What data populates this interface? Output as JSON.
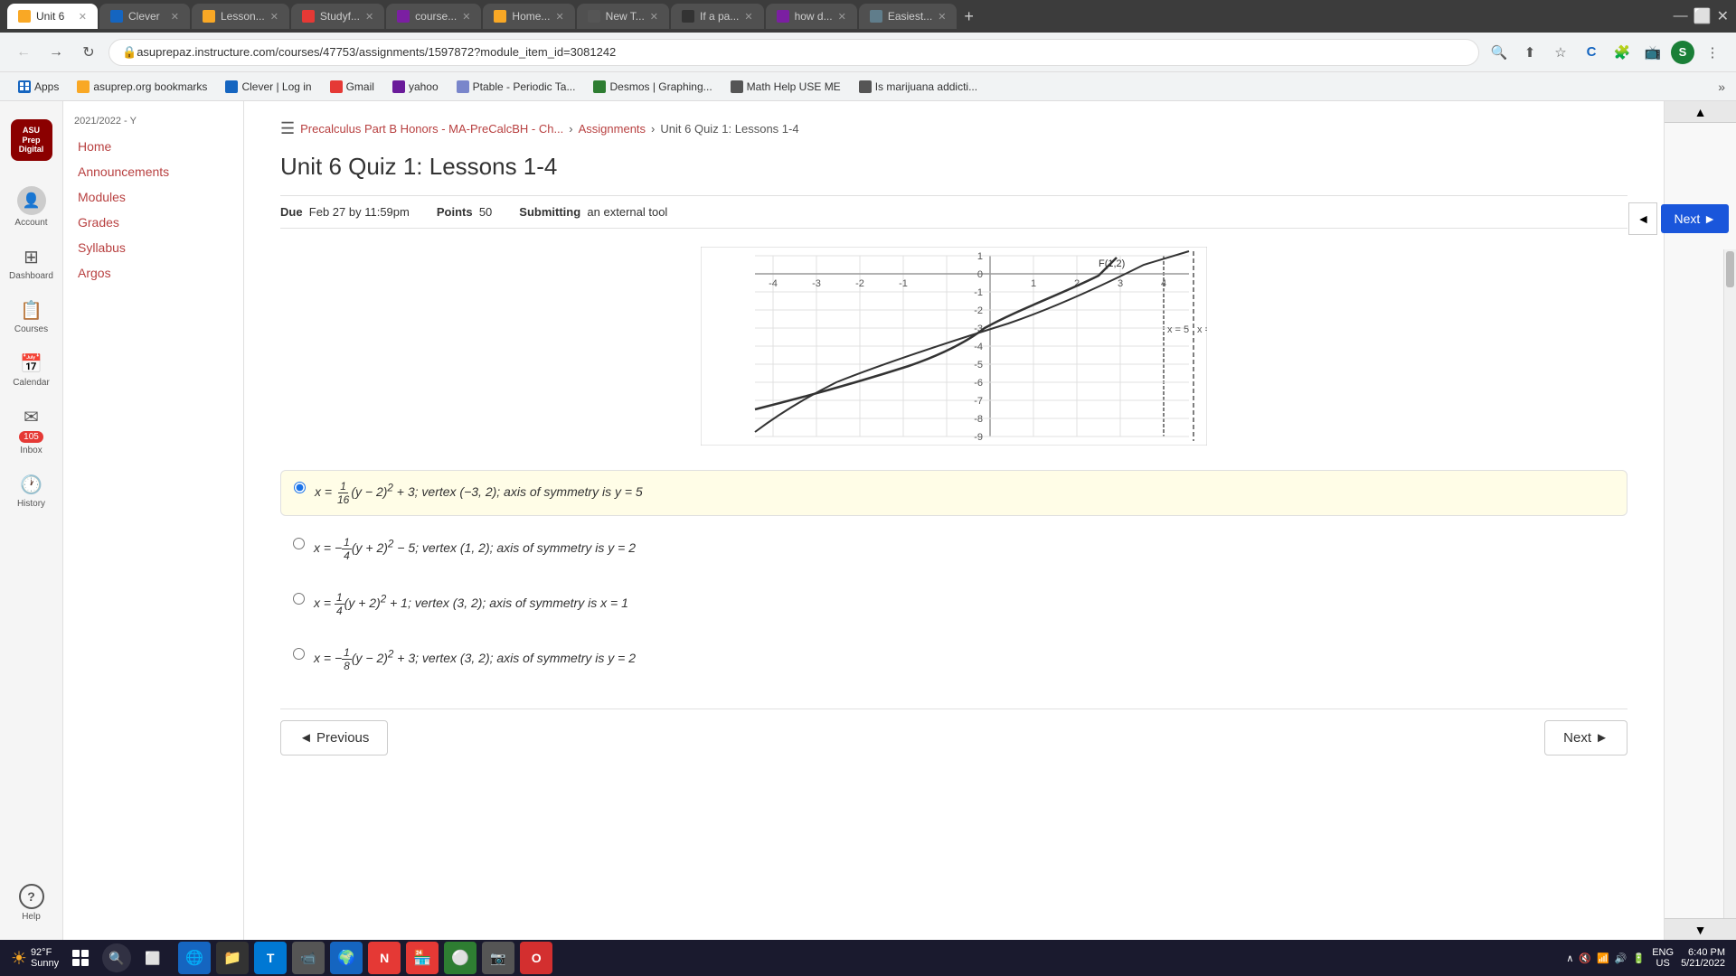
{
  "browser": {
    "tabs": [
      {
        "id": "clever",
        "title": "Clever",
        "active": false,
        "color": "#1565c0"
      },
      {
        "id": "lesson",
        "title": "Lesson...",
        "active": false,
        "color": "#f9a825"
      },
      {
        "id": "unit6",
        "title": "Unit 6",
        "active": true,
        "color": "#f9a825"
      },
      {
        "id": "studyf",
        "title": "Studyf...",
        "active": false,
        "color": "#e53935"
      },
      {
        "id": "course",
        "title": "course...",
        "active": false,
        "color": "#7b1fa2"
      },
      {
        "id": "home",
        "title": "Home...",
        "active": false,
        "color": "#f9a825"
      },
      {
        "id": "newt",
        "title": "New T...",
        "active": false,
        "color": "#555"
      },
      {
        "id": "ifapa",
        "title": "If a pa...",
        "active": false,
        "color": "#333"
      },
      {
        "id": "howd",
        "title": "how d...",
        "active": false,
        "color": "#7b1fa2"
      },
      {
        "id": "easiest",
        "title": "Easiest...",
        "active": false,
        "color": "#607d8b"
      }
    ],
    "url": "asuprepaz.instructure.com/courses/47753/assignments/1597872?module_item_id=3081242",
    "bookmarks": [
      {
        "label": "Apps",
        "color": "#1565c0"
      },
      {
        "label": "asuprep.org bookmarks"
      },
      {
        "label": "Clever | Log in",
        "color": "#1565c0"
      },
      {
        "label": "Gmail",
        "color": "#e53935"
      },
      {
        "label": "yahoo",
        "color": "#6a1b9a"
      },
      {
        "label": "Ptable - Periodic Ta...",
        "color": "#7986cb"
      },
      {
        "label": "Desmos | Graphing...",
        "color": "#2e7d32"
      },
      {
        "label": "Math Help USE ME",
        "color": "#555"
      },
      {
        "label": "Is marijuana addicti...",
        "color": "#555"
      }
    ]
  },
  "left_nav": {
    "logo_lines": [
      "ASU",
      "Prep",
      "Digital"
    ],
    "items": [
      {
        "id": "account",
        "icon": "👤",
        "label": "Account"
      },
      {
        "id": "dashboard",
        "icon": "⊞",
        "label": "Dashboard"
      },
      {
        "id": "courses",
        "icon": "📋",
        "label": "Courses"
      },
      {
        "id": "calendar",
        "icon": "📅",
        "label": "Calendar"
      },
      {
        "id": "inbox",
        "icon": "✉",
        "label": "Inbox",
        "badge": "105"
      },
      {
        "id": "history",
        "icon": "🕐",
        "label": "History"
      },
      {
        "id": "help",
        "icon": "?",
        "label": "Help"
      }
    ]
  },
  "sidebar": {
    "year": "2021/2022 - Y",
    "links": [
      {
        "label": "Home"
      },
      {
        "label": "Announcements"
      },
      {
        "label": "Modules"
      },
      {
        "label": "Grades"
      },
      {
        "label": "Syllabus"
      },
      {
        "label": "Argos"
      }
    ]
  },
  "breadcrumb": {
    "course": "Precalculus Part B Honors - MA-PreCalcBH - Ch...",
    "assignments": "Assignments",
    "current": "Unit 6 Quiz 1: Lessons 1-4"
  },
  "quiz": {
    "title": "Unit 6 Quiz 1: Lessons 1-4",
    "due_label": "Due",
    "due_value": "Feb 27 by 11:59pm",
    "points_label": "Points",
    "points_value": "50",
    "submitting_label": "Submitting",
    "submitting_value": "an external tool"
  },
  "graph": {
    "focus_label": "F(1,2)",
    "directrix_label": "x = 5",
    "x_min": -5,
    "x_max": 5,
    "y_min": -9,
    "y_max": 1
  },
  "choices": [
    {
      "id": "a",
      "selected": true,
      "text": "x = 1/16(y − 2)² + 3; vertex (−3, 2); axis of symmetry is y = 5"
    },
    {
      "id": "b",
      "selected": false,
      "text": "x = −1/4(y + 2)² − 5; vertex (1, 2); axis of symmetry is y = 2"
    },
    {
      "id": "c",
      "selected": false,
      "text": "x = 1/4(y + 2)² + 1; vertex (3, 2); axis of symmetry is x = 1"
    },
    {
      "id": "d",
      "selected": false,
      "text": "x = −1/8(y − 2)² + 3; vertex (3, 2); axis of symmetry is y = 2"
    }
  ],
  "nav_buttons": {
    "previous": "◄ Previous",
    "next_main": "Next ►",
    "next_side": "Next ►"
  },
  "taskbar": {
    "time": "6:40 PM",
    "date": "5/21/2022",
    "locale": "ENG\nUS",
    "weather_temp": "92°F",
    "weather_desc": "Sunny"
  }
}
